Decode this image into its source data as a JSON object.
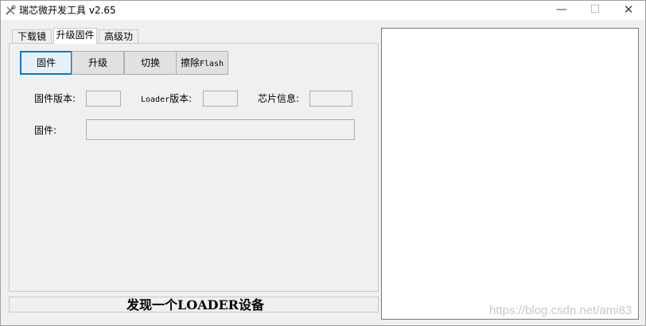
{
  "window": {
    "title": "瑞芯微开发工具 v2.65",
    "controls": {
      "minimize": "—",
      "maximize": "☐",
      "close": "✕"
    }
  },
  "tabs": [
    {
      "label": "下载镜像",
      "active": false
    },
    {
      "label": "升级固件",
      "active": true
    },
    {
      "label": "高级功能",
      "active": false
    }
  ],
  "toolbar": {
    "firmware_label": "固件",
    "upgrade_label": "升级",
    "switch_label": "切换",
    "erase_prefix": "擦除",
    "erase_suffix": "Flash"
  },
  "info": {
    "firmware_version_label": "固件版本:",
    "firmware_version_value": "",
    "loader_version_prefix": "Loader",
    "loader_version_suffix": "版本:",
    "loader_version_value": "",
    "chip_info_label": "芯片信息:",
    "chip_info_value": "",
    "firmware_path_label": "固件:",
    "firmware_path_value": ""
  },
  "status": {
    "text": "发现一个LOADER设备"
  },
  "log": {
    "content": ""
  },
  "watermark": "https://blog.csdn.net/ami83",
  "colors": {
    "accent": "#0078d7",
    "window_bg": "#f0f0f0",
    "panel_bg": "#ffffff"
  }
}
